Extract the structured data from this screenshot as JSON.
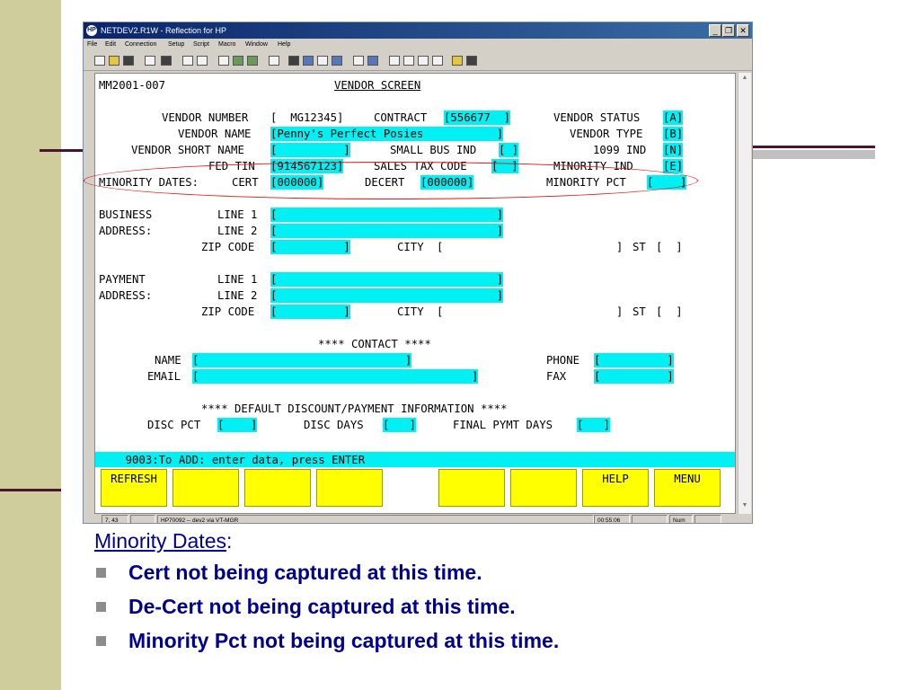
{
  "window": {
    "title": "NETDEV2.R1W - Reflection for HP",
    "app_icon": "HP",
    "controls": [
      "_",
      "❐",
      "✕"
    ],
    "menu": [
      "File",
      "Edit",
      "Connection",
      "Setup",
      "Script",
      "Macro",
      "Window",
      "Help"
    ]
  },
  "toolbar_icons": [
    "new-icon",
    "open-icon",
    "save-icon",
    "print-icon",
    "find-icon",
    "copy-icon",
    "paste-icon",
    "connect-icon",
    "transfer-icon",
    "host-icon",
    "clear-icon",
    "display-icon",
    "settings-icon",
    "keyboard-icon",
    "mouse-icon",
    "tools-icon",
    "send-icon",
    "receive-icon",
    "record-icon",
    "stop-icon",
    "help-icon",
    "book-icon"
  ],
  "screen": {
    "id": "MM2001-007",
    "title": "VENDOR SCREEN",
    "labels": {
      "vendor_number": "VENDOR NUMBER",
      "contract": "CONTRACT",
      "vendor_status": "VENDOR STATUS",
      "vendor_name": "VENDOR NAME",
      "vendor_type": "VENDOR TYPE",
      "vendor_short_name": "VENDOR SHORT NAME",
      "small_bus_ind": "SMALL BUS IND",
      "ind_1099": "1099 IND",
      "fed_tin": "FED TIN",
      "sales_tax_code": "SALES TAX CODE",
      "minority_ind": "MINORITY IND",
      "minority_dates": "MINORITY DATES:",
      "cert": "CERT",
      "decert": "DECERT",
      "minority_pct": "MINORITY PCT",
      "business": "BUSINESS",
      "address": "ADDRESS:",
      "payment": "PAYMENT",
      "line1": "LINE 1",
      "line2": "LINE 2",
      "zip_code": "ZIP CODE",
      "city": "CITY",
      "st": "ST",
      "contact_header": "**** CONTACT ****",
      "name": "NAME",
      "email": "EMAIL",
      "phone": "PHONE",
      "fax": "FAX",
      "discount_header": "**** DEFAULT DISCOUNT/PAYMENT INFORMATION ****",
      "disc_pct": "DISC PCT",
      "disc_days": "DISC DAYS",
      "final_pymt_days": "FINAL PYMT DAYS"
    },
    "fields": {
      "vendor_number": "[  MG12345]",
      "contract": "[556677  ]",
      "vendor_status": "[A]",
      "vendor_name": "[Penny's Perfect Posies           ]",
      "vendor_type": "[B]",
      "vendor_short_name": "[          ]",
      "small_bus_ind": "[ ]",
      "ind_1099": "[N]",
      "fed_tin": "[914567123]",
      "sales_tax_code": "[  ]",
      "minority_ind": "[E]",
      "cert": "[000000]",
      "decert": "[000000]",
      "minority_pct": "[    ]",
      "bus_line1": "[                                 ]",
      "bus_line2": "[                                 ]",
      "bus_zip": "[          ]",
      "bus_city": "[                          ]",
      "bus_st": "[  ]",
      "pay_line1": "[                                 ]",
      "pay_line2": "[                                 ]",
      "pay_zip": "[          ]",
      "pay_city": "[                          ]",
      "pay_st": "[  ]",
      "contact_name": "[                               ]",
      "phone": "[          ]",
      "email": "[                                         ]",
      "fax": "[          ]",
      "disc_pct": "[    ]",
      "disc_days": "[   ]",
      "final_pymt_days": "[   ]"
    },
    "message": "    9003:To ADD: enter data, press ENTER",
    "function_keys": [
      "REFRESH",
      "",
      "",
      "",
      "",
      "",
      "",
      "HELP",
      "MENU"
    ]
  },
  "statusbar": {
    "cursor": "7, 43",
    "blank1": "",
    "connection": "HP70092 -- dev2 via VT-MGR",
    "time": "00:55:06",
    "blank2": "",
    "num": "Num"
  },
  "notes": {
    "title": "Minority Dates",
    "title_colon": ":",
    "bullets": [
      "Cert not being captured at this time.",
      "De-Cert not being captured at this time.",
      "Minority Pct not being captured at this time."
    ]
  },
  "colors": {
    "field": "#00f0f4",
    "function_key": "#ffff00",
    "annotation": "#d81a1a",
    "notes_text": "#00008b",
    "slide_bar": "#cfcd9c"
  }
}
